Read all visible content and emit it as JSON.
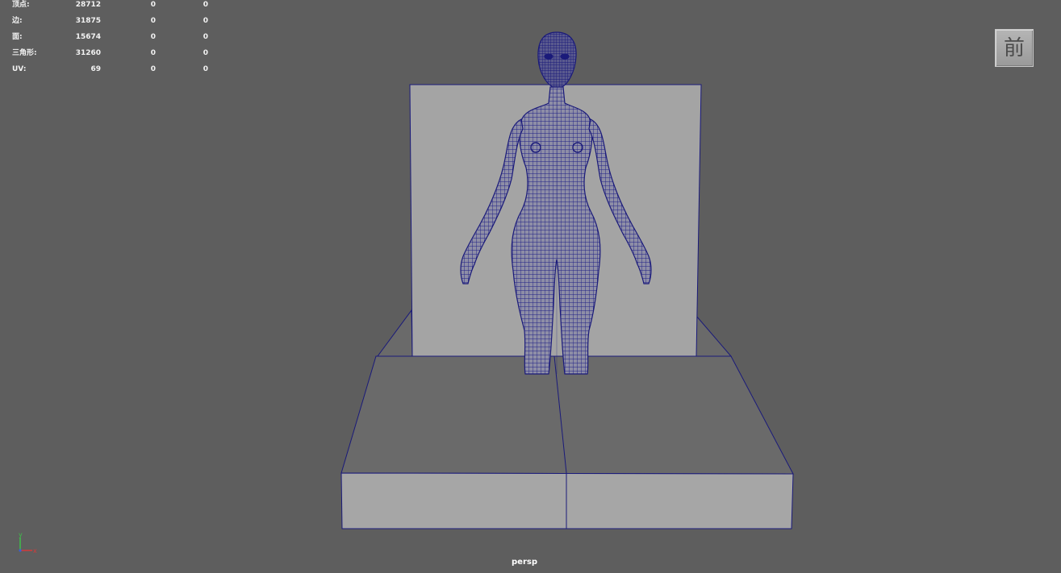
{
  "hud": {
    "rows": [
      {
        "label": "顶点:",
        "v1": "28712",
        "v2": "0",
        "v3": "0"
      },
      {
        "label": "边:",
        "v1": "31875",
        "v2": "0",
        "v3": "0"
      },
      {
        "label": "面:",
        "v1": "15674",
        "v2": "0",
        "v3": "0"
      },
      {
        "label": "三角形:",
        "v1": "31260",
        "v2": "0",
        "v3": "0"
      },
      {
        "label": "UV:",
        "v1": "69",
        "v2": "0",
        "v3": "0"
      }
    ]
  },
  "viewcube": {
    "face_label": "前"
  },
  "camera": {
    "name": "persp"
  },
  "axis": {
    "y_label": "y",
    "x_label": "x"
  },
  "colors": {
    "background": "#5e5e5e",
    "wireframe": "#1a1a7a",
    "backdrop": "#a4a4a4",
    "platform_top": "#6a6a6a",
    "platform_front": "#a6a6a6"
  }
}
